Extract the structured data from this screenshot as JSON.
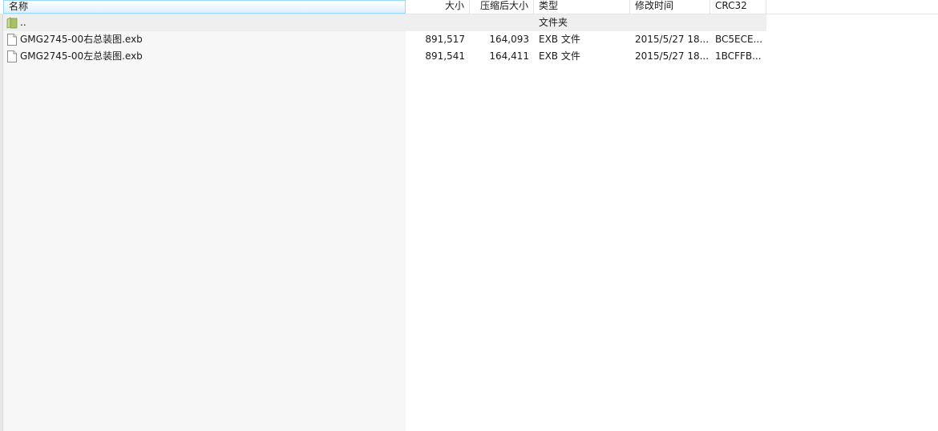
{
  "columns": {
    "name": "名称",
    "size": "大小",
    "packed": "压缩后大小",
    "type": "类型",
    "modified": "修改时间",
    "crc": "CRC32"
  },
  "parent_row": {
    "name": "..",
    "type": "文件夹"
  },
  "files": [
    {
      "name": "GMG2745-00右总装图.exb",
      "size": "891,517",
      "packed": "164,093",
      "type": "EXB 文件",
      "modified": "2015/5/27 18...",
      "crc": "BC5ECE..."
    },
    {
      "name": "GMG2745-00左总装图.exb",
      "size": "891,541",
      "packed": "164,411",
      "type": "EXB 文件",
      "modified": "2015/5/27 18...",
      "crc": "1BCFFB..."
    }
  ],
  "colors": {
    "sorted_header": "#96d9f9",
    "name_column_bg": "#f7f7f7",
    "folder_icon": "#a7c06a"
  },
  "icons": {
    "parent": "folder-icon",
    "file": "file-icon"
  }
}
